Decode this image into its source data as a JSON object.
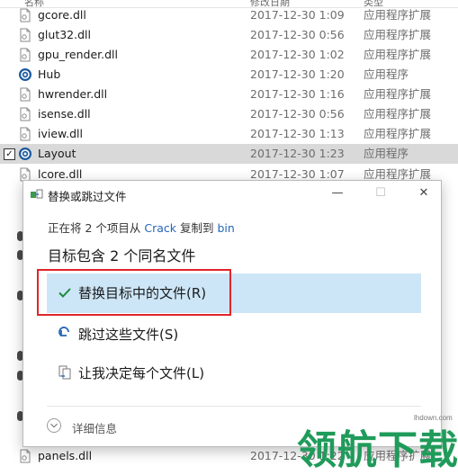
{
  "columns": {
    "name": "名称",
    "date": "修改日期",
    "type": "类型"
  },
  "files": [
    {
      "name": "gcore.dll",
      "date": "2017-12-30 1:09",
      "type": "应用程序扩展",
      "icon": "dll-file-icon"
    },
    {
      "name": "glut32.dll",
      "date": "2017-12-30 0:56",
      "type": "应用程序扩展",
      "icon": "dll-file-icon"
    },
    {
      "name": "gpu_render.dll",
      "date": "2017-12-30 1:02",
      "type": "应用程序扩展",
      "icon": "dll-file-icon"
    },
    {
      "name": "Hub",
      "date": "2017-12-30 1:20",
      "type": "应用程序",
      "icon": "hub-app-icon"
    },
    {
      "name": "hwrender.dll",
      "date": "2017-12-30 1:16",
      "type": "应用程序扩展",
      "icon": "dll-file-icon"
    },
    {
      "name": "isense.dll",
      "date": "2017-12-30 0:56",
      "type": "应用程序扩展",
      "icon": "dll-file-icon"
    },
    {
      "name": "iview.dll",
      "date": "2017-12-30 1:13",
      "type": "应用程序扩展",
      "icon": "dll-file-icon"
    },
    {
      "name": "Layout",
      "date": "2017-12-30 1:23",
      "type": "应用程序",
      "icon": "layout-app-icon",
      "selected": true
    },
    {
      "name": "lcore.dll",
      "date": "2017-12-30 1:07",
      "type": "应用程序扩展",
      "icon": "dll-file-icon"
    },
    {
      "name": "panels.dll",
      "date": "2017-12-30 1:22",
      "type": "应用程序扩展",
      "icon": "dll-file-icon"
    }
  ],
  "dialog": {
    "title": "替换或跳过文件",
    "info_prefix": "正在将 2 个项目从 ",
    "info_source": "Crack",
    "info_middle": " 复制到 ",
    "info_dest": "bin",
    "heading": "目标包含 2 个同名文件",
    "options": {
      "replace": "替换目标中的文件(R)",
      "skip": "跳过这些文件(S)",
      "decide": "让我决定每个文件(L)"
    },
    "details": "详细信息",
    "titlebar_buttons": {
      "minimize": "—",
      "maximize": "☐",
      "close": "✕"
    }
  },
  "watermark": {
    "text": "领航下载",
    "url": "lhdown.com"
  },
  "colors": {
    "accent": "#2566b8",
    "highlight": "#cde6f7",
    "annotation": "#e0252a",
    "watermark": "#1f9b5a"
  }
}
